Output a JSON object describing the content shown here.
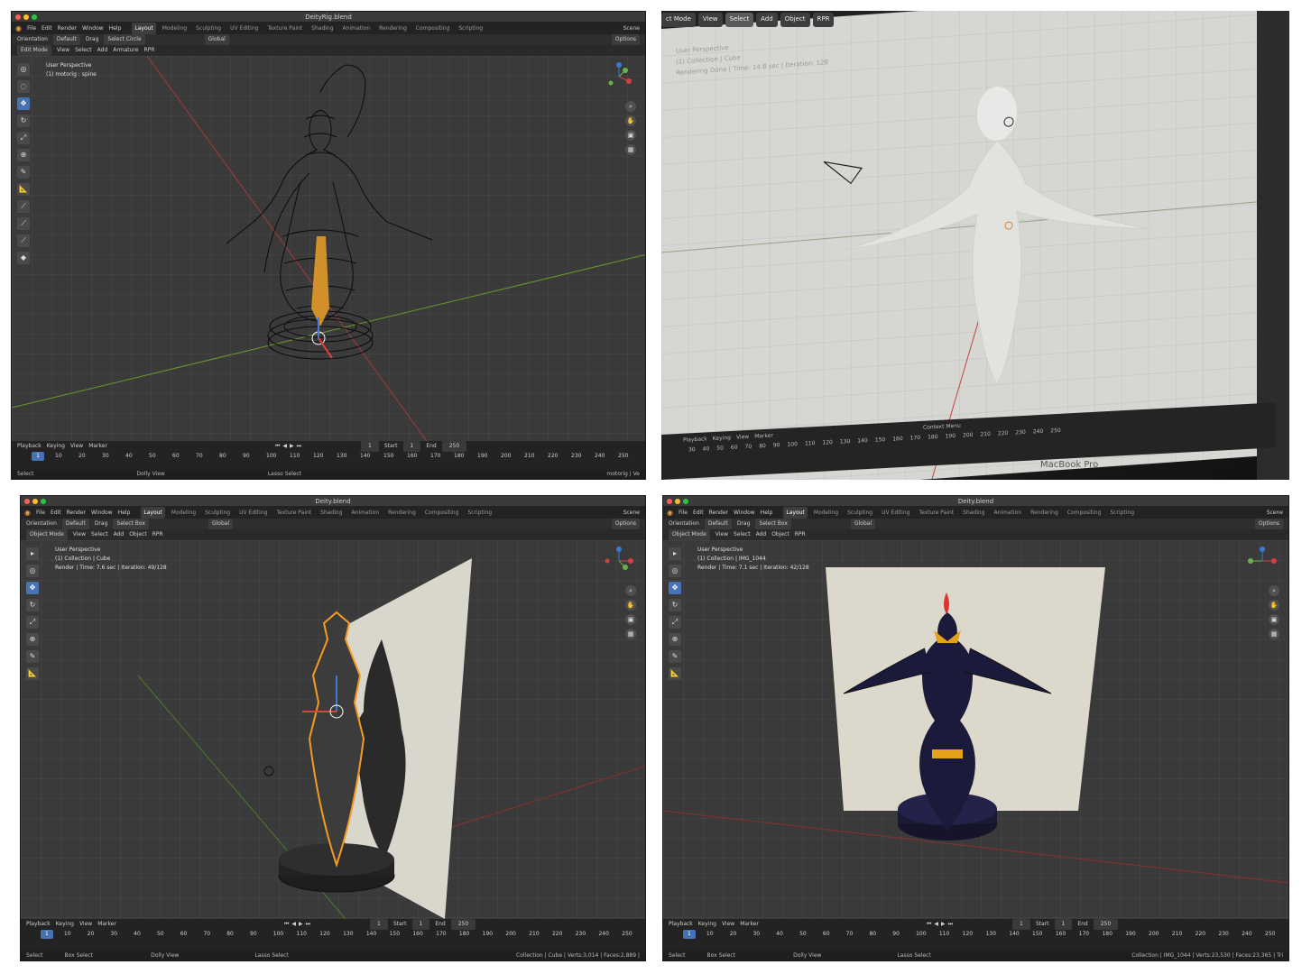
{
  "panel1": {
    "title": "DeityRig.blend",
    "menu": [
      "File",
      "Edit",
      "Render",
      "Window",
      "Help"
    ],
    "workspaces": [
      "Layout",
      "Modeling",
      "Sculpting",
      "UV Editing",
      "Texture Paint",
      "Shading",
      "Animation",
      "Rendering",
      "Compositing",
      "Scripting"
    ],
    "active_workspace": "Layout",
    "scene": "Scene",
    "toolrow": {
      "orientation": "Orientation",
      "default": "Default",
      "drag": "Drag",
      "select": "Select Circle",
      "transform": "Global",
      "options": "Options"
    },
    "header": {
      "mode": "Edit Mode",
      "view": "View",
      "select": "Select",
      "add": "Add",
      "armature": "Armature",
      "rpr": "RPR"
    },
    "viewport_info": [
      "User Perspective",
      "(1) motorig : spine"
    ],
    "timeline": {
      "playback": "Playback",
      "keying": "Keying",
      "view": "View",
      "marker": "Marker",
      "current_frame": "1",
      "start_label": "Start",
      "start": "1",
      "end_label": "End",
      "end": "250"
    },
    "frames": [
      "1",
      "10",
      "20",
      "30",
      "40",
      "50",
      "60",
      "70",
      "80",
      "90",
      "100",
      "110",
      "120",
      "130",
      "140",
      "150",
      "160",
      "170",
      "180",
      "190",
      "200",
      "210",
      "220",
      "230",
      "240",
      "250"
    ],
    "status": {
      "select": "Select",
      "dolly": "Dolly View",
      "lasso": "Lasso Select",
      "stats": "motorig | Ve"
    }
  },
  "panel2": {
    "menu": [
      "ct Mode",
      "View",
      "Select",
      "Add",
      "Object",
      "RPR"
    ],
    "viewport_info": [
      "User Perspective",
      "(1) Collection | Cube",
      "Rendering Done | Time: 14.8 sec | Iteration: 128"
    ],
    "timeline": {
      "playback": "Playback",
      "keying": "Keying",
      "view": "View",
      "marker": "Marker"
    },
    "frames": [
      "30",
      "40",
      "50",
      "60",
      "70",
      "80",
      "90",
      "100",
      "110",
      "120",
      "130",
      "140",
      "150",
      "160",
      "170",
      "180",
      "190",
      "200",
      "210",
      "220",
      "230",
      "240",
      "250"
    ],
    "context_menu": "Context Menu",
    "brand": "MacBook Pro"
  },
  "panel3": {
    "title": "Deity.blend",
    "menu": [
      "File",
      "Edit",
      "Render",
      "Window",
      "Help"
    ],
    "workspaces": [
      "Layout",
      "Modeling",
      "Sculpting",
      "UV Editing",
      "Texture Paint",
      "Shading",
      "Animation",
      "Rendering",
      "Compositing",
      "Scripting"
    ],
    "active_workspace": "Layout",
    "scene": "Scene",
    "toolrow": {
      "orientation": "Orientation",
      "default": "Default",
      "drag": "Drag",
      "select": "Select Box",
      "transform": "Global",
      "options": "Options"
    },
    "header": {
      "mode": "Object Mode",
      "view": "View",
      "select": "Select",
      "add": "Add",
      "object": "Object",
      "rpr": "RPR"
    },
    "viewport_info": [
      "User Perspective",
      "(1) Collection | Cube",
      "Render | Time: 7.6 sec | Iteration: 49/128"
    ],
    "timeline": {
      "playback": "Playback",
      "keying": "Keying",
      "view": "View",
      "marker": "Marker",
      "current_frame": "1",
      "start_label": "Start",
      "start": "1",
      "end_label": "End",
      "end": "250"
    },
    "frames": [
      "1",
      "10",
      "20",
      "30",
      "40",
      "50",
      "60",
      "70",
      "80",
      "90",
      "100",
      "110",
      "120",
      "130",
      "140",
      "150",
      "160",
      "170",
      "180",
      "190",
      "200",
      "210",
      "220",
      "230",
      "240",
      "250"
    ],
    "status": {
      "select": "Select",
      "box": "Box Select",
      "dolly": "Dolly View",
      "lasso": "Lasso Select",
      "stats": "Collection | Cube | Verts:3,014 | Faces:2,889 |"
    }
  },
  "panel4": {
    "title": "Deity.blend",
    "menu": [
      "File",
      "Edit",
      "Render",
      "Window",
      "Help"
    ],
    "workspaces": [
      "Layout",
      "Modeling",
      "Sculpting",
      "UV Editing",
      "Texture Paint",
      "Shading",
      "Animation",
      "Rendering",
      "Compositing",
      "Scripting"
    ],
    "active_workspace": "Layout",
    "scene": "Scene",
    "toolrow": {
      "orientation": "Orientation",
      "default": "Default",
      "drag": "Drag",
      "select": "Select Box",
      "transform": "Global",
      "options": "Options"
    },
    "header": {
      "mode": "Object Mode",
      "view": "View",
      "select": "Select",
      "add": "Add",
      "object": "Object",
      "rpr": "RPR"
    },
    "viewport_info": [
      "User Perspective",
      "(1) Collection | IMG_1044",
      "Render | Time: 7.1 sec | Iteration: 42/128"
    ],
    "timeline": {
      "playback": "Playback",
      "keying": "Keying",
      "view": "View",
      "marker": "Marker",
      "current_frame": "1",
      "start_label": "Start",
      "start": "1",
      "end_label": "End",
      "end": "250"
    },
    "frames": [
      "1",
      "10",
      "20",
      "30",
      "40",
      "50",
      "60",
      "70",
      "80",
      "90",
      "100",
      "110",
      "120",
      "130",
      "140",
      "150",
      "160",
      "170",
      "180",
      "190",
      "200",
      "210",
      "220",
      "230",
      "240",
      "250"
    ],
    "status": {
      "select": "Select",
      "box": "Box Select",
      "dolly": "Dolly View",
      "lasso": "Lasso Select",
      "stats": "Collection | IMG_1044 | Verts:23,530 | Faces:23,365 | Tri"
    }
  },
  "colors": {
    "accent": "#4772b3",
    "header": "#232323",
    "viewport": "#3a3a3a",
    "gold": "#e3a21a",
    "navy": "#1c1a3a",
    "selection": "#f59a23"
  },
  "icons": [
    "blender-logo-icon",
    "cursor-icon",
    "move-icon",
    "rotate-icon",
    "scale-icon",
    "transform-icon",
    "annotate-icon",
    "measure-icon",
    "zoom-icon",
    "pan-icon",
    "camera-icon",
    "grid-icon",
    "play-icon",
    "jump-start-icon",
    "jump-end-icon"
  ]
}
